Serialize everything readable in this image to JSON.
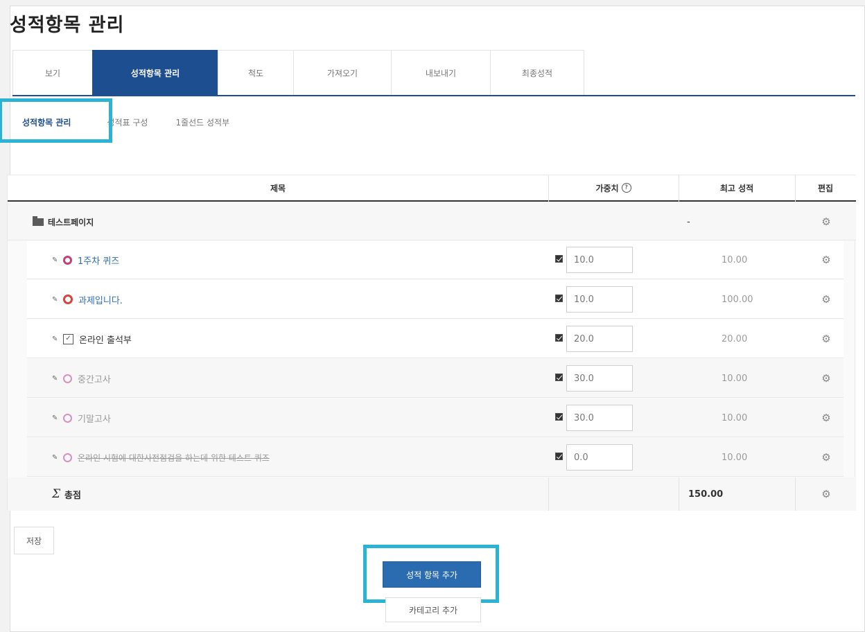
{
  "page": {
    "title": "성적항목 관리"
  },
  "tabs": [
    {
      "label": "보기"
    },
    {
      "label": "성적항목 관리"
    },
    {
      "label": "척도"
    },
    {
      "label": "가져오기"
    },
    {
      "label": "내보내기"
    },
    {
      "label": "최종성적"
    }
  ],
  "subtabs": [
    {
      "label": "성적항목 관리"
    },
    {
      "label": "성적표 구성"
    },
    {
      "label": "1줄선드 성적부"
    }
  ],
  "table": {
    "headers": {
      "title": "제목",
      "weight": "가중치",
      "help": "?",
      "max_grade": "최고 성적",
      "edit": "편집"
    },
    "category": {
      "name": "테스트페이지",
      "max": "-"
    },
    "rows": [
      {
        "name": "1주차 퀴즈",
        "weight": "10.0",
        "max": "10.00",
        "icon": "quiz-icon"
      },
      {
        "name": "과제입니다.",
        "weight": "10.0",
        "max": "100.00",
        "icon": "assignment-icon"
      },
      {
        "name": "온라인 출석부",
        "weight": "20.0",
        "max": "20.00",
        "icon": "attendance-icon"
      },
      {
        "name": "중간고사",
        "weight": "30.0",
        "max": "10.00",
        "icon": "quiz-icon"
      },
      {
        "name": "기말고사",
        "weight": "30.0",
        "max": "10.00",
        "icon": "quiz-icon"
      },
      {
        "name": "온라인 시험에 대한사전점검을 하는데 위한 테스트 퀴즈",
        "weight": "0.0",
        "max": "10.00",
        "icon": "quiz-icon"
      }
    ],
    "total": {
      "symbol": "Σ",
      "label": "총점",
      "max": "150.00"
    }
  },
  "buttons": {
    "save": "저장",
    "add_grade_item": "성적 항목 추가",
    "add_category": "카테고리 추가"
  },
  "colors": {
    "accent": "#1d4e8f",
    "highlight": "#2ab3d2",
    "button": "#2b6cb0",
    "link": "#2d6fb6"
  }
}
